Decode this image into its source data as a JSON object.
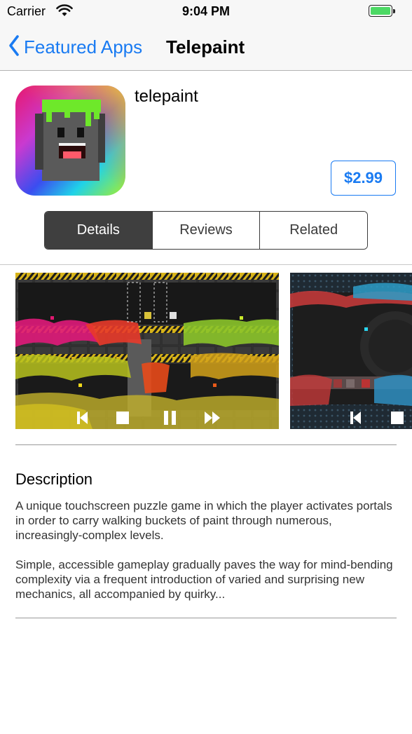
{
  "status_bar": {
    "carrier": "Carrier",
    "time": "9:04 PM",
    "wifi_icon": "wifi-icon",
    "battery_icon": "battery-icon",
    "battery_color": "#4cd964"
  },
  "nav": {
    "back_label": "Featured Apps",
    "title": "Telepaint",
    "accent_color": "#1a7bf2"
  },
  "app": {
    "name": "telepaint",
    "price": "$2.99",
    "icon": "telepaint-app-icon"
  },
  "tabs": [
    {
      "label": "Details",
      "selected": true
    },
    {
      "label": "Reviews",
      "selected": false
    },
    {
      "label": "Related",
      "selected": false
    }
  ],
  "screenshots": [
    {
      "name": "gameplay-screenshot-1",
      "controls": [
        "skip-back-icon",
        "stop-icon",
        "pause-icon",
        "fast-forward-icon"
      ]
    },
    {
      "name": "gameplay-screenshot-2",
      "controls": [
        "skip-back-icon",
        "stop-icon"
      ]
    }
  ],
  "description": {
    "title": "Description",
    "paragraphs": [
      "A unique touchscreen puzzle game in which the player activates portals in order to carry walking buckets of paint through numerous, increasingly-complex levels.",
      "Simple, accessible gameplay gradually paves the way for mind-bending complexity via a frequent introduction of varied and surprising new mechanics, all accompanied by quirky..."
    ]
  }
}
